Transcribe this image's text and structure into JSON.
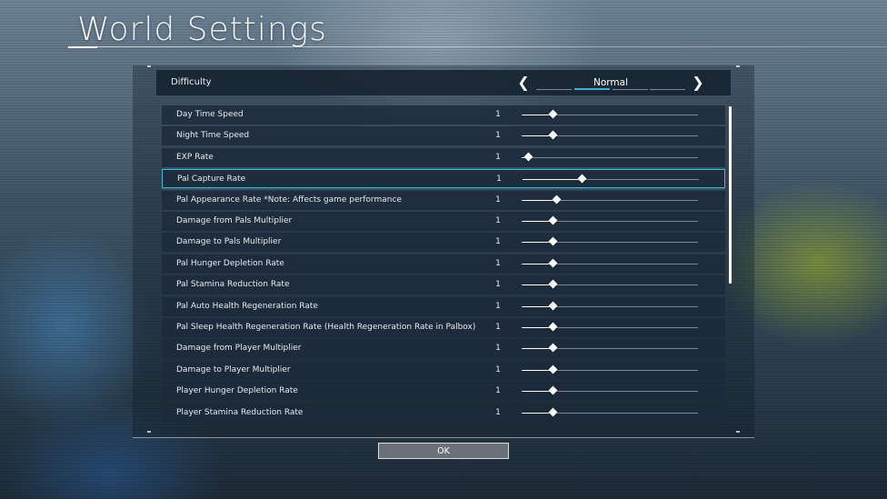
{
  "window": {
    "title": "World Settings"
  },
  "difficulty": {
    "label": "Difficulty",
    "value": "Normal",
    "segments": 4,
    "active_segment": 1,
    "prev_icon": "chevron-left-icon",
    "next_icon": "chevron-right-icon"
  },
  "settings": [
    {
      "label": "Day Time Speed",
      "value": "1",
      "slider_fraction": 0.18
    },
    {
      "label": "Night Time Speed",
      "value": "1",
      "slider_fraction": 0.18
    },
    {
      "label": "EXP Rate",
      "value": "1",
      "slider_fraction": 0.04
    },
    {
      "label": "Pal Capture Rate",
      "value": "1",
      "slider_fraction": 0.34,
      "selected": true
    },
    {
      "label": "Pal Appearance Rate *Note: Affects game performance",
      "value": "1",
      "slider_fraction": 0.2
    },
    {
      "label": "Damage from Pals Multiplier",
      "value": "1",
      "slider_fraction": 0.18
    },
    {
      "label": "Damage to Pals Multiplier",
      "value": "1",
      "slider_fraction": 0.18
    },
    {
      "label": "Pal Hunger Depletion Rate",
      "value": "1",
      "slider_fraction": 0.18
    },
    {
      "label": "Pal Stamina Reduction Rate",
      "value": "1",
      "slider_fraction": 0.18
    },
    {
      "label": "Pal Auto Health Regeneration Rate",
      "value": "1",
      "slider_fraction": 0.18
    },
    {
      "label": "Pal Sleep Health Regeneration Rate (Health Regeneration Rate in Palbox)",
      "value": "1",
      "slider_fraction": 0.18
    },
    {
      "label": "Damage from Player Multiplier",
      "value": "1",
      "slider_fraction": 0.18
    },
    {
      "label": "Damage to Player Multiplier",
      "value": "1",
      "slider_fraction": 0.18
    },
    {
      "label": "Player Hunger Depletion Rate",
      "value": "1",
      "slider_fraction": 0.18
    },
    {
      "label": "Player Stamina Reduction Rate",
      "value": "1",
      "slider_fraction": 0.18
    }
  ],
  "footer": {
    "ok_label": "OK"
  },
  "colors": {
    "accent": "#3fb6d6",
    "row_bg": "#1c2a3a",
    "text": "#e6ebef"
  }
}
